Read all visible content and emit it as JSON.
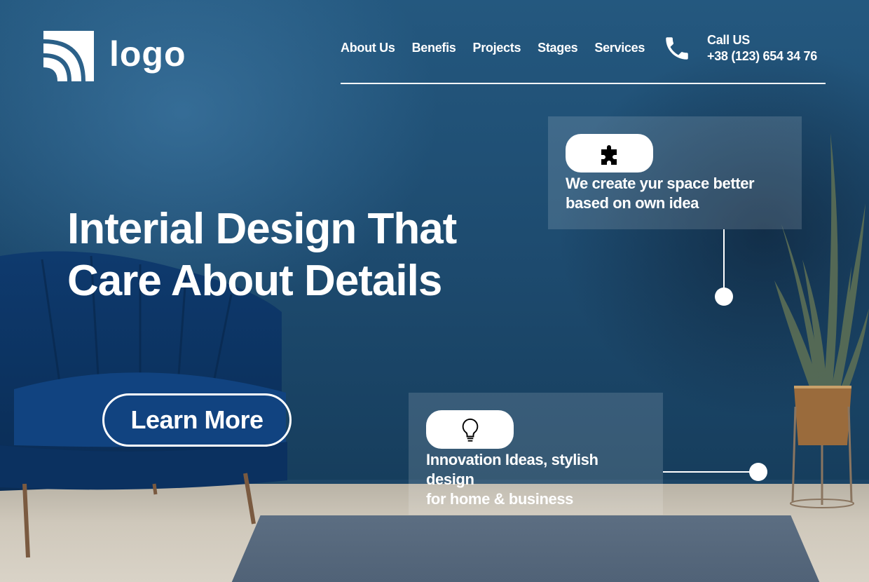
{
  "colors": {
    "wall": "#1d4a6e",
    "text": "#ffffff",
    "floor": "#cfc8bb",
    "rug": "#55677b"
  },
  "header": {
    "logo_text": "logo",
    "nav": [
      "About Us",
      "Benefis",
      "Projects",
      "Stages",
      "Services"
    ],
    "call_label": "Call US",
    "phone": "+38 (123) 654 34 76"
  },
  "hero": {
    "title": "Interial Design That\nCare About Details",
    "button_label": "Learn More"
  },
  "cards": [
    {
      "icon": "puzzle-icon",
      "text": "We create yur space better\nbased on own idea"
    },
    {
      "icon": "lightbulb-icon",
      "text": "Innovation Ideas, stylish\ndesign\nfor home & business"
    }
  ]
}
